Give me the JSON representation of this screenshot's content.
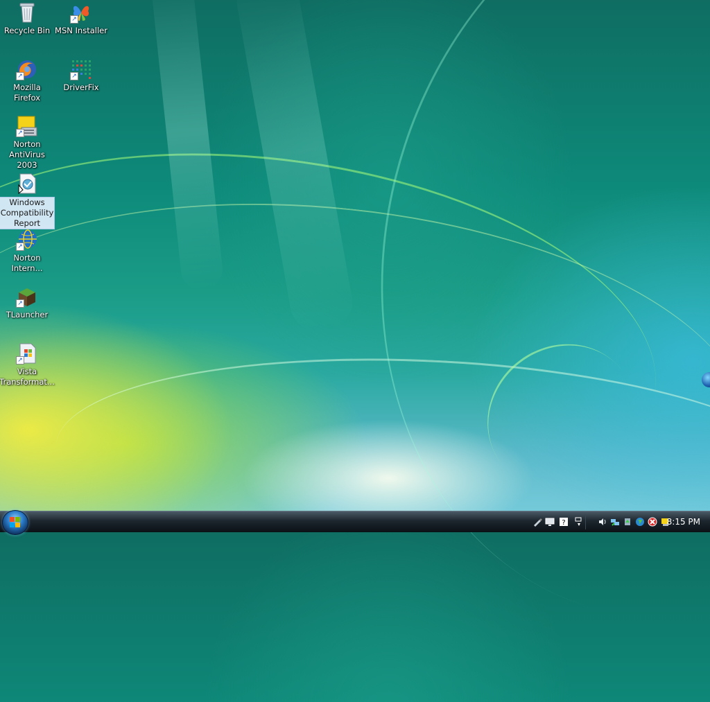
{
  "desktop": {
    "icons": [
      {
        "label": "Recycle Bin",
        "icon": "recycle-bin-icon",
        "shortcut": false,
        "selected": false
      },
      {
        "label": "MSN Installer",
        "icon": "msn-butterfly-icon",
        "shortcut": true,
        "selected": false
      },
      {
        "label": "Mozilla Firefox",
        "icon": "firefox-icon",
        "shortcut": true,
        "selected": false
      },
      {
        "label": "DriverFix",
        "icon": "driverfix-icon",
        "shortcut": true,
        "selected": false
      },
      {
        "label": "Norton AntiVirus 2003",
        "icon": "norton-antivirus-icon",
        "shortcut": true,
        "selected": false
      },
      {
        "label": "Windows Compatibility Report",
        "icon": "compatibility-report-icon",
        "shortcut": false,
        "selected": true
      },
      {
        "label": "Norton Intern...",
        "icon": "norton-internet-icon",
        "shortcut": true,
        "selected": false
      },
      {
        "label": "TLauncher",
        "icon": "tlauncher-icon",
        "shortcut": true,
        "selected": false
      },
      {
        "label": "Vista Transformat...",
        "icon": "vista-transformation-icon",
        "shortcut": true,
        "selected": false
      }
    ]
  },
  "taskbar": {
    "clock": "8:15 PM",
    "tray_icons": [
      "pen-icon",
      "network-monitor-icon",
      "help-icon",
      "task-switch-icon",
      "volume-icon",
      "network-icon",
      "safely-remove-icon",
      "globe-icon",
      "security-alert-icon",
      "windows-defender-icon"
    ]
  },
  "colors": {
    "taskbar": "#1d262e",
    "selection": "#dcebf9",
    "accent": "#2a7ac8"
  }
}
